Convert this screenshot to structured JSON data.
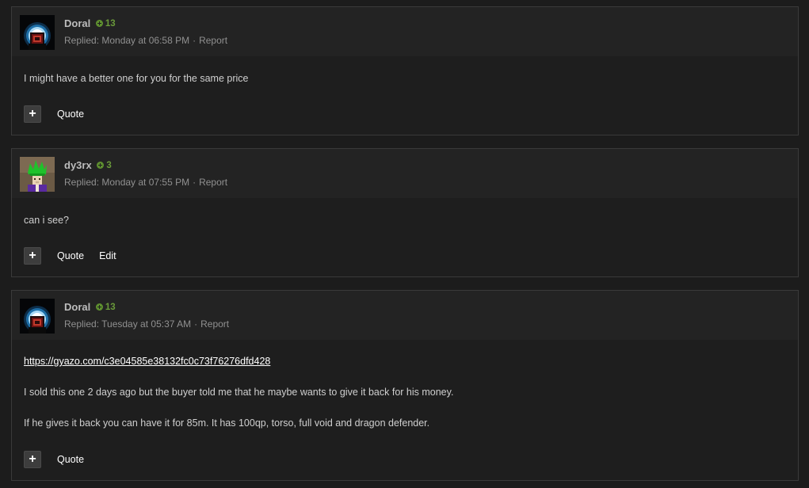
{
  "posts": [
    {
      "author": "Doral",
      "reputation": "13",
      "replied": "Replied: Monday at 06:58 PM",
      "separator": "·",
      "report_label": "Report",
      "avatar_icon": "dark-portal-avatar",
      "body": [
        "I might have a better one for you for the same price"
      ],
      "actions": {
        "plus": "+",
        "quote": "Quote"
      }
    },
    {
      "author": "dy3rx",
      "reputation": "3",
      "replied": "Replied: Monday at 07:55 PM",
      "separator": "·",
      "report_label": "Report",
      "avatar_icon": "green-partyhat-avatar",
      "body": [
        "can i see?"
      ],
      "actions": {
        "plus": "+",
        "quote": "Quote",
        "edit": "Edit"
      }
    },
    {
      "author": "Doral",
      "reputation": "13",
      "replied": "Replied: Tuesday at 05:37 AM",
      "separator": "·",
      "report_label": "Report",
      "avatar_icon": "dark-portal-avatar",
      "link": "https://gyazo.com/c3e04585e38132fc0c73f76276dfd428",
      "body": [
        "I sold this one 2 days ago but the buyer told me that he maybe wants to give it back for his money.",
        "If he gives it back you can have it for 85m. It has 100qp, torso, full void and dragon defender."
      ],
      "actions": {
        "plus": "+",
        "quote": "Quote"
      }
    }
  ],
  "colors": {
    "background": "#1c1c1c",
    "post_background": "#1e1e1e",
    "header_background": "#232323",
    "reputation_green": "#6a9a3a",
    "link": "#ffffff"
  }
}
